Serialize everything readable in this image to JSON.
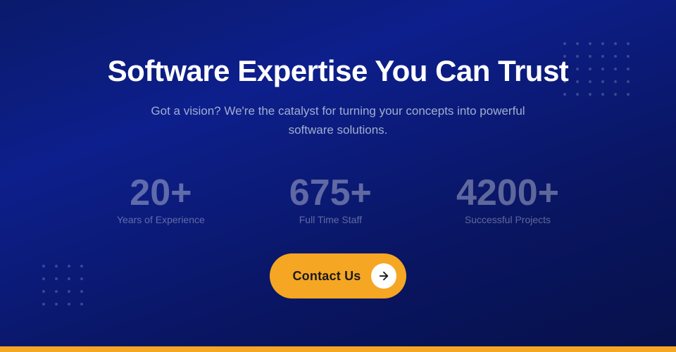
{
  "page": {
    "background": "#0a1a6b"
  },
  "hero": {
    "title": "Software Expertise You Can Trust",
    "subtitle": "Got a vision? We're the catalyst for turning your concepts into powerful software solutions."
  },
  "stats": [
    {
      "number": "20+",
      "label": "Years of Experience"
    },
    {
      "number": "675+",
      "label": "Full Time Staff"
    },
    {
      "number": "4200+",
      "label": "Successful Projects"
    }
  ],
  "cta": {
    "label": "Contact Us",
    "arrow": "→"
  }
}
